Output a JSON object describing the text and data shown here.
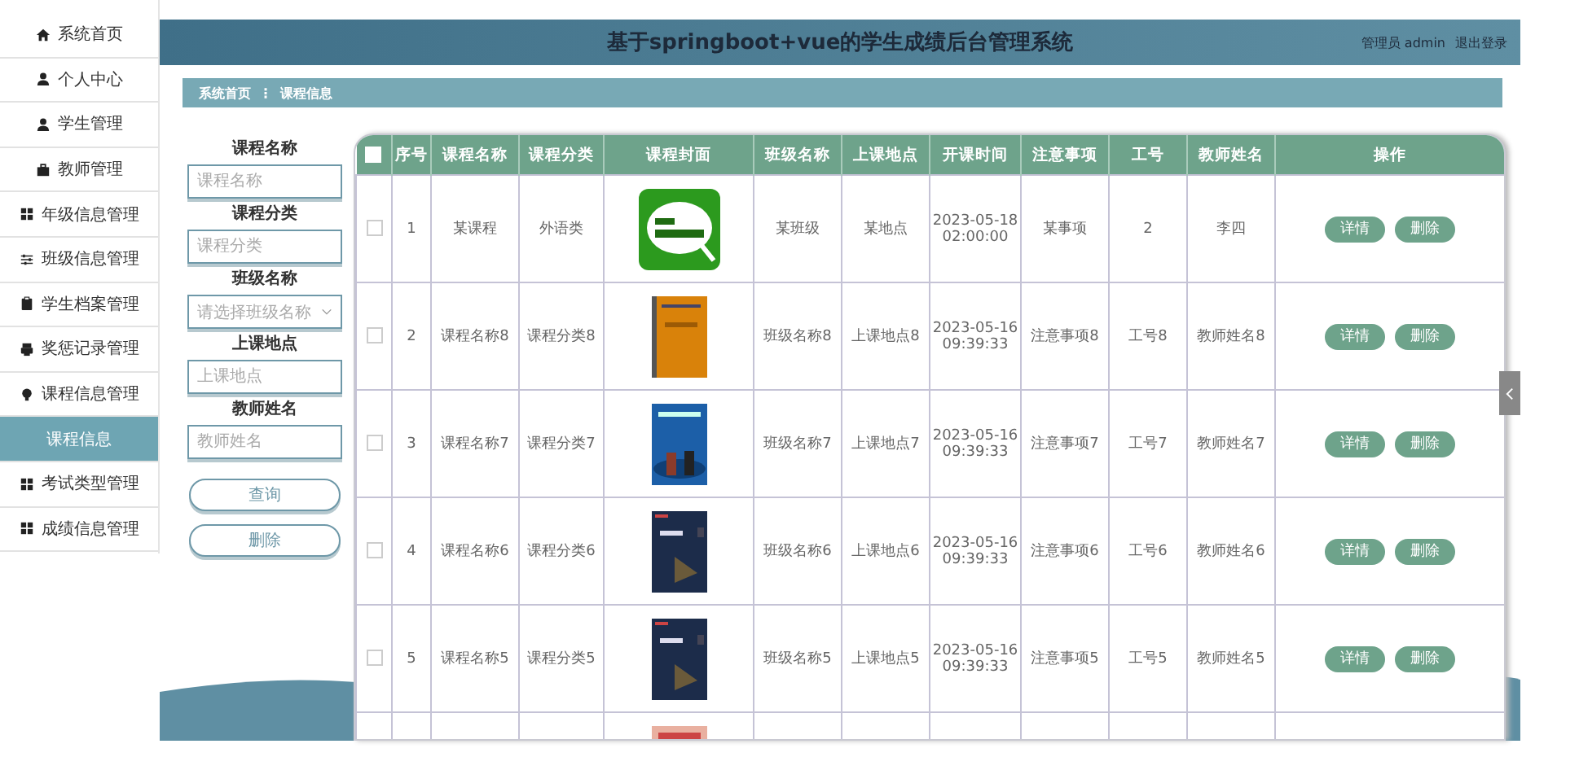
{
  "sidebar": {
    "items": [
      {
        "label": "系统首页",
        "selected": false
      },
      {
        "label": "个人中心",
        "selected": false
      },
      {
        "label": "学生管理",
        "selected": false
      },
      {
        "label": "教师管理",
        "selected": false
      },
      {
        "label": "年级信息管理",
        "selected": false
      },
      {
        "label": "班级信息管理",
        "selected": false
      },
      {
        "label": "学生档案管理",
        "selected": false
      },
      {
        "label": "奖惩记录管理",
        "selected": false
      },
      {
        "label": "课程信息管理",
        "selected": false,
        "expanded": true,
        "children": [
          {
            "label": "课程信息",
            "selected": true
          }
        ]
      },
      {
        "label": "考试类型管理",
        "selected": false
      },
      {
        "label": "成绩信息管理",
        "selected": false
      }
    ]
  },
  "header": {
    "title": "基于springboot+vue的学生成绩后台管理系统",
    "user": "管理员 admin",
    "logout": "退出登录"
  },
  "breadcrumb": {
    "items": [
      "系统首页",
      "课程信息"
    ],
    "separator": "⋮"
  },
  "search": {
    "fields": [
      {
        "label": "课程名称",
        "placeholder": "课程名称",
        "kind": "input"
      },
      {
        "label": "课程分类",
        "placeholder": "课程分类",
        "kind": "input"
      },
      {
        "label": "班级名称",
        "placeholder": "请选择班级名称",
        "kind": "select"
      },
      {
        "label": "上课地点",
        "placeholder": "上课地点",
        "kind": "input"
      },
      {
        "label": "教师姓名",
        "placeholder": "教师姓名",
        "kind": "input"
      }
    ],
    "buttons": [
      "查询",
      "删除"
    ]
  },
  "table": {
    "select_all": {
      "checked": false
    },
    "columns": [
      "序号",
      "课程名称",
      "课程分类",
      "课程封面",
      "班级名称",
      "上课地点",
      "开课时间",
      "注意事项",
      "工号",
      "教师姓名",
      "操作"
    ],
    "rows": [
      {
        "checked": false,
        "cells": [
          "1",
          "某课程",
          "外语类"
        ],
        "cover": {
          "kind": "picture"
        },
        "cells2": [
          "某班级",
          "某地点",
          "2023-05-18 02:00:00",
          "某事项",
          "2",
          "李四"
        ],
        "actions": [
          "详情",
          "删除"
        ]
      },
      {
        "checked": false,
        "cells": [
          "2",
          "课程名称8",
          "课程分类8"
        ],
        "cover": {
          "kind": "picture"
        },
        "cells2": [
          "班级名称8",
          "上课地点8",
          "2023-05-16 09:39:33",
          "注意事项8",
          "工号8",
          "教师姓名8"
        ],
        "actions": [
          "详情",
          "删除"
        ]
      },
      {
        "checked": false,
        "cells": [
          "3",
          "课程名称7",
          "课程分类7"
        ],
        "cover": {
          "kind": "picture"
        },
        "cells2": [
          "班级名称7",
          "上课地点7",
          "2023-05-16 09:39:33",
          "注意事项7",
          "工号7",
          "教师姓名7"
        ],
        "actions": [
          "详情",
          "删除"
        ]
      },
      {
        "checked": false,
        "cells": [
          "4",
          "课程名称6",
          "课程分类6"
        ],
        "cover": {
          "kind": "picture"
        },
        "cells2": [
          "班级名称6",
          "上课地点6",
          "2023-05-16 09:39:33",
          "注意事项6",
          "工号6",
          "教师姓名6"
        ],
        "actions": [
          "详情",
          "删除"
        ]
      },
      {
        "checked": false,
        "cells": [
          "5",
          "课程名称5",
          "课程分类5"
        ],
        "cover": {
          "kind": "picture"
        },
        "cells2": [
          "班级名称5",
          "上课地点5",
          "2023-05-16 09:39:33",
          "注意事项5",
          "工号5",
          "教师姓名5"
        ],
        "actions": [
          "详情",
          "删除"
        ]
      },
      {
        "cover": {
          "kind": "picture"
        }
      }
    ]
  }
}
